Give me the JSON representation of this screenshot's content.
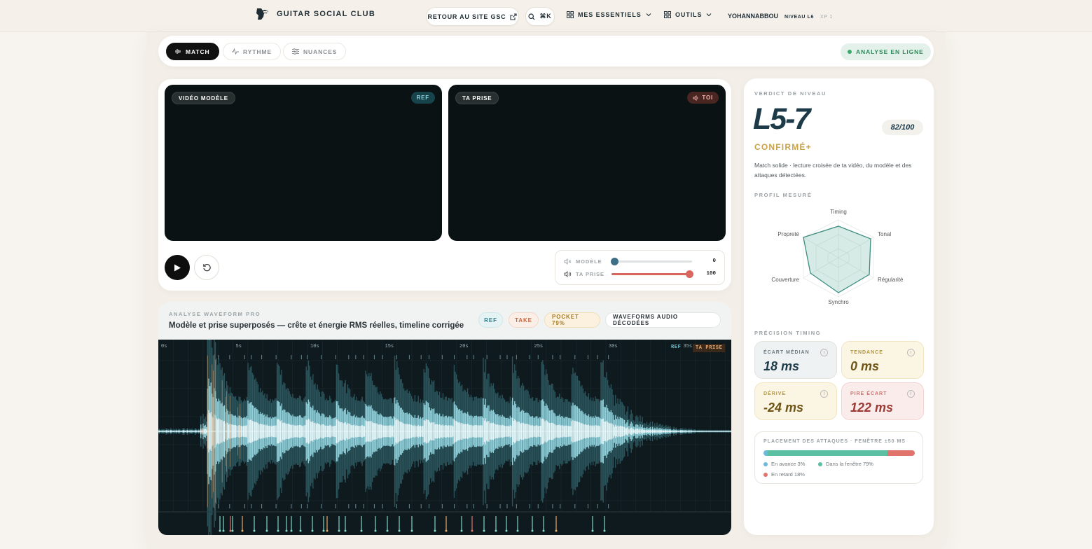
{
  "topbar": {
    "brand": "GUITAR SOCIAL CLUB",
    "back_label": "RETOUR AU SITE GSC",
    "search_shortcut": "⌘K",
    "menu_essentials": "MES ESSENTIELS",
    "menu_tools": "OUTILS",
    "username": "YOHANNABBOU",
    "level": "NIVEAU L6",
    "xp": "XP 1"
  },
  "tabs": {
    "match": "MATCH",
    "rhythm": "RYTHME",
    "nuances": "NUANCES",
    "status": "ANALYSE EN LIGNE"
  },
  "video": {
    "model_label": "VIDÉO MODÈLE",
    "model_tag": "REF",
    "take_label": "TA PRISE",
    "take_tag": "TOI"
  },
  "mixer": {
    "model_label": "MODÈLE",
    "model_value": "0",
    "model_level": 0,
    "take_label": "TA PRISE",
    "take_value": "100",
    "take_level": 100
  },
  "waveform": {
    "kicker": "ANALYSE WAVEFORM PRO",
    "title": "Modèle et prise superposés — crête et énergie RMS réelles, timeline corrigée",
    "chip_ref": "REF",
    "chip_take": "TAKE",
    "chip_pocket": "POCKET 79%",
    "chip_decoded": "WAVEFORMS AUDIO DÉCODÉES",
    "time_labels": [
      "0s",
      "5s",
      "10s",
      "15s",
      "20s",
      "25s",
      "30s",
      "35s"
    ],
    "legend_ref": "REF",
    "legend_take": "TA PRISE"
  },
  "verdict": {
    "kicker": "VERDICT DE NIVEAU",
    "level": "L5-7",
    "score": "82/100",
    "grade": "CONFIRMÉ+",
    "description": "Match solide · lecture croisée de ta vidéo, du modèle et des attaques détectées.",
    "profile_kicker": "PROFIL MESURÉ",
    "radar_axes": [
      "Timing",
      "Tonal",
      "Régularité",
      "Synchro",
      "Couverture",
      "Propreté"
    ],
    "timing_kicker": "PRÉCISION TIMING",
    "median_label": "ÉCART MÉDIAN",
    "median_value": "18 ms",
    "trend_label": "TENDANCE",
    "trend_value": "0 ms",
    "drift_label": "DÉRIVE",
    "drift_value": "-24 ms",
    "worst_label": "PIRE ÉCART",
    "worst_value": "122 ms",
    "placement_label": "PLACEMENT DES ATTAQUES · FENÊTRE ±50 MS",
    "early_label": "En avance 3%",
    "window_label": "Dans la fenêtre 79%",
    "late_label": "En retard 18%",
    "early_pct": 3,
    "window_pct": 79,
    "late_pct": 18
  },
  "colors": {
    "accent_gold": "#c9a24a",
    "ref_teal": "#3a8f9a",
    "take_red": "#d9665d",
    "online_green": "#3aaa6c"
  }
}
